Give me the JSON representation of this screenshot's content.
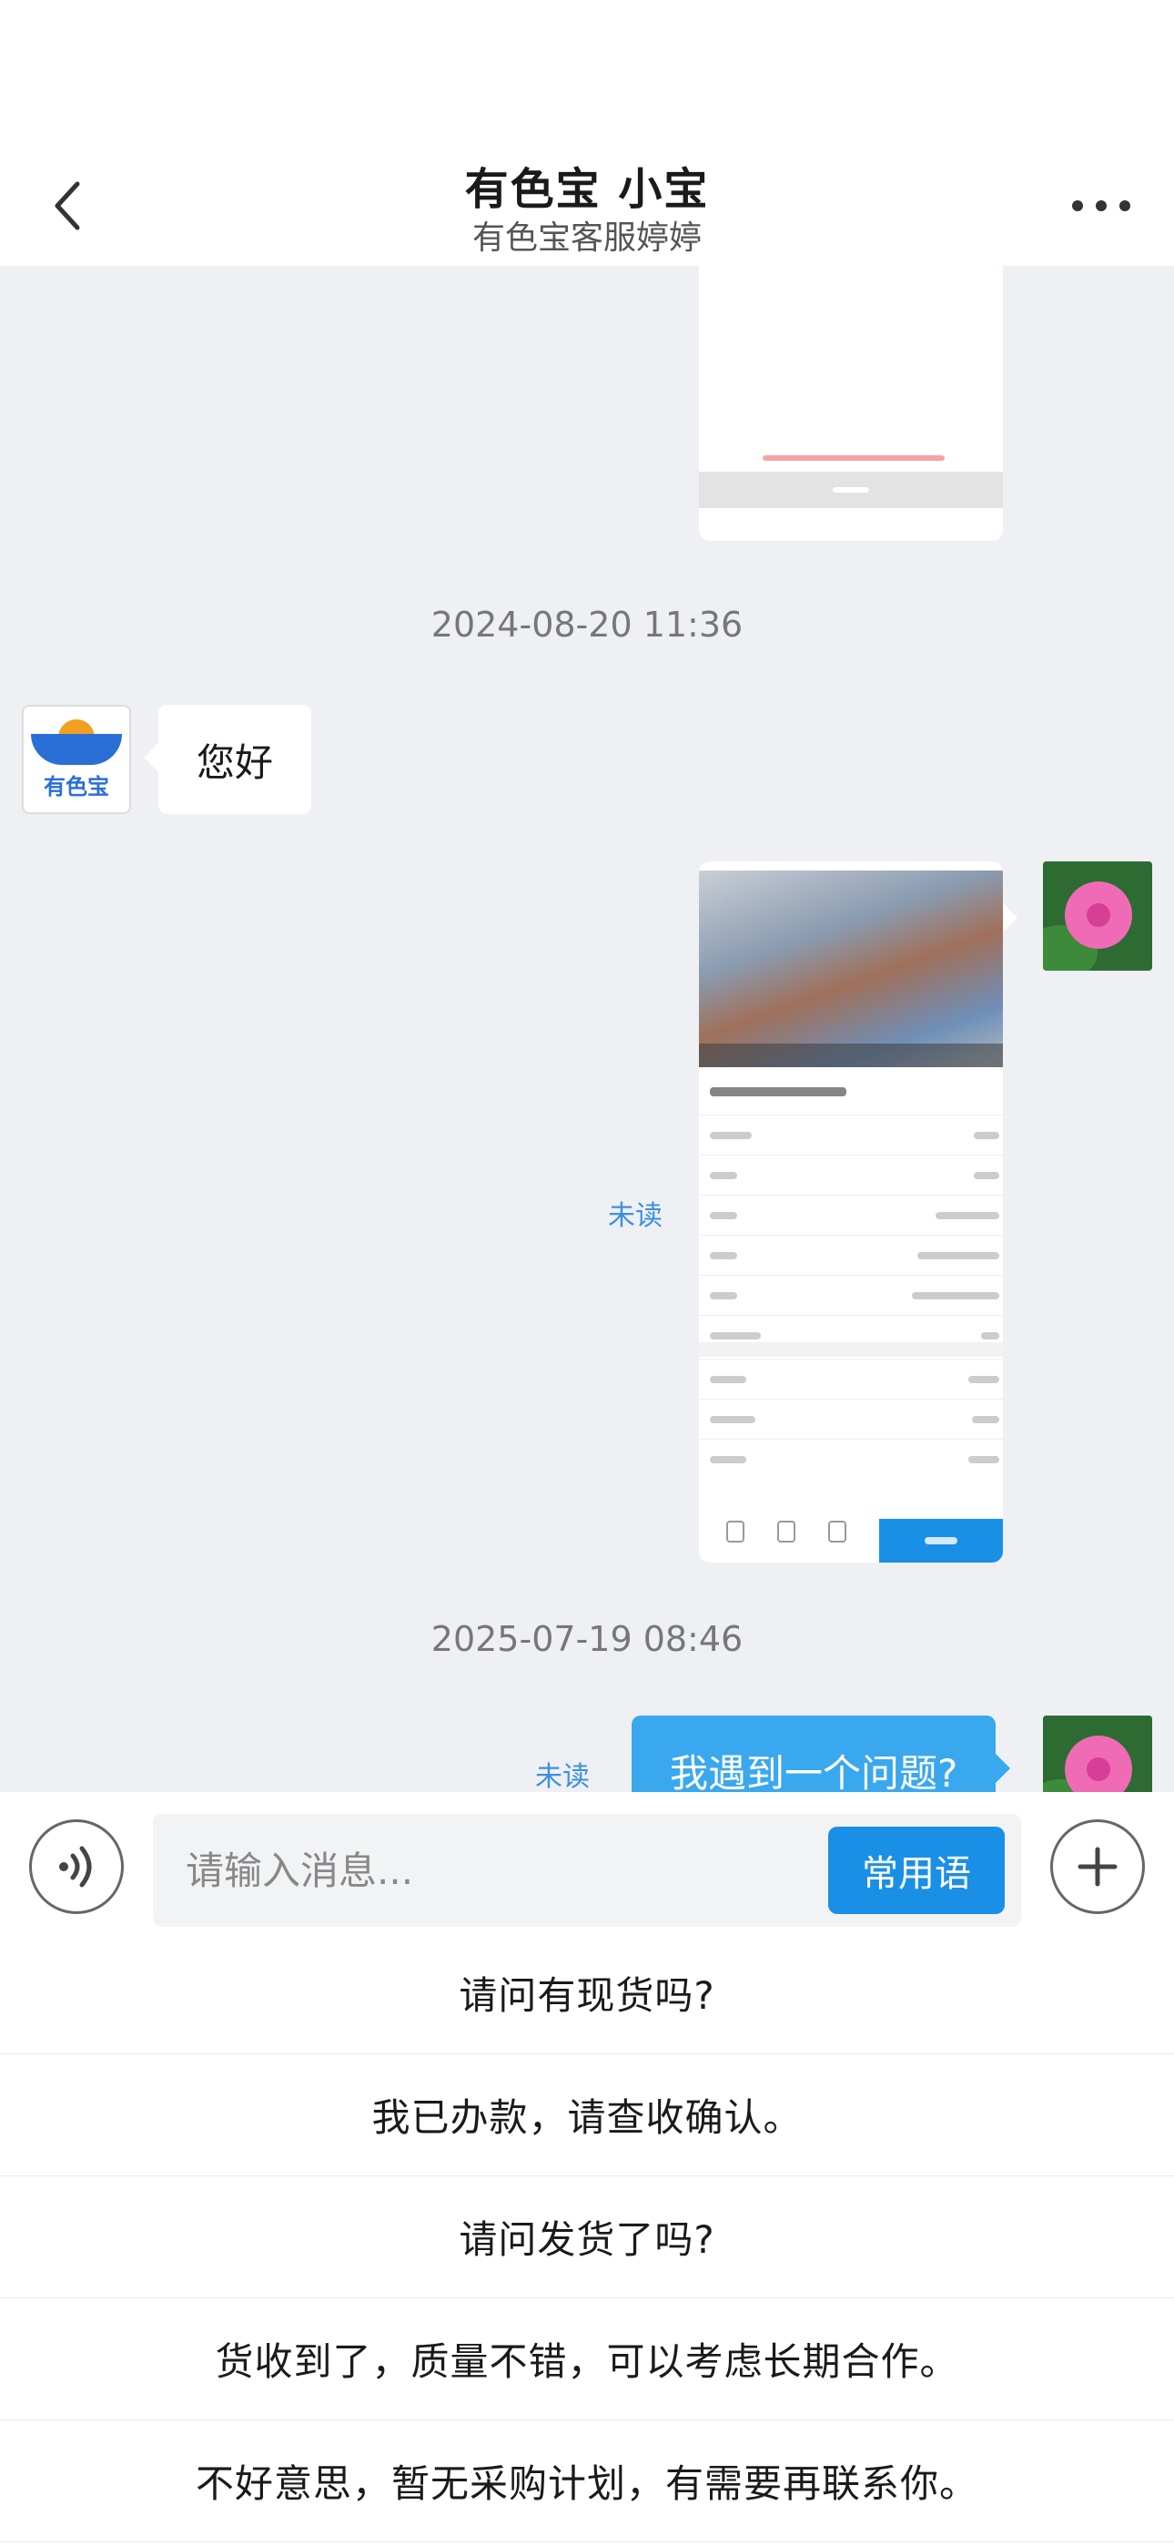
{
  "header": {
    "title": "有色宝 小宝",
    "subtitle": "有色宝客服婷婷"
  },
  "avatars": {
    "service_logo_text": "有色宝"
  },
  "messages": {
    "timestamp_1": "2024-08-20 11:36",
    "greeting": "您好",
    "unread_label_1": "未读",
    "timestamp_2": "2025-07-19 08:46",
    "question": "我遇到一个问题?",
    "unread_label_2": "未读"
  },
  "input": {
    "placeholder": "请输入消息...",
    "phrases_button": "常用语"
  },
  "quick_phrases": [
    "请问有现货吗?",
    "我已办款，请查收确认。",
    "请问发货了吗?",
    "货收到了，质量不错，可以考虑长期合作。",
    "不好意思，暂无采购计划，有需要再联系你。"
  ],
  "icons": {
    "back": "chevron-left-icon",
    "more": "more-horizontal-icon",
    "voice": "voice-icon",
    "plus": "plus-icon"
  },
  "colors": {
    "accent": "#1a8fe6",
    "bubble_sent": "#3aa8ee",
    "unread_text": "#3d8fe0",
    "chat_background": "#eef0f3"
  }
}
